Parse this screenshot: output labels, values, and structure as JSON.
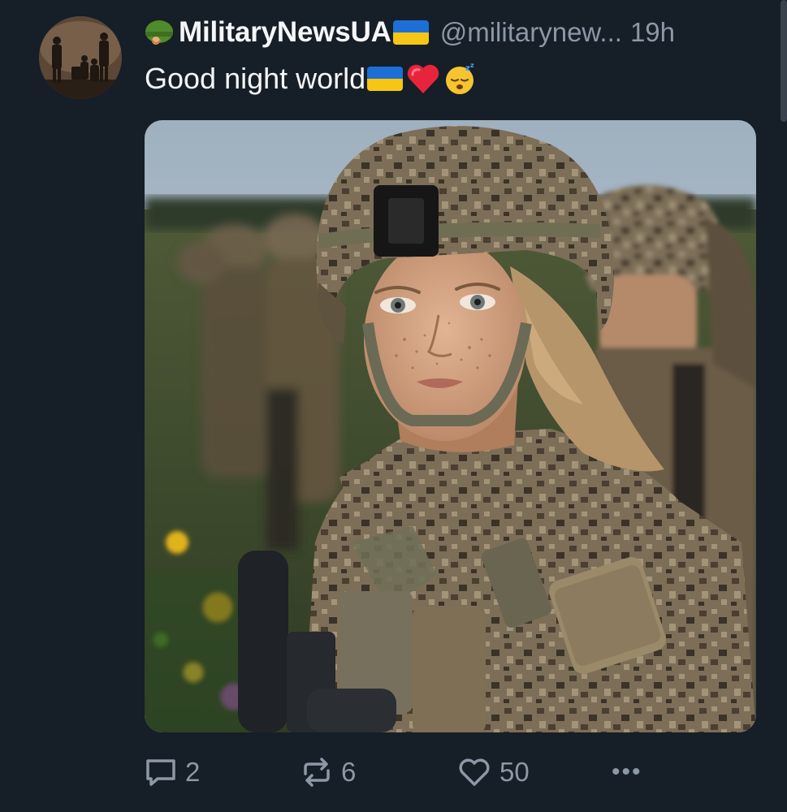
{
  "author": {
    "display_name": "MilitaryNewsUA",
    "handle": "@militarynew...",
    "time": "19h",
    "badge_icon": "military-helmet-emoji",
    "flag_icon": "ukraine-flag-emoji",
    "flag_colors": [
      "#1d6fd6",
      "#f7c614"
    ]
  },
  "post": {
    "text": "Good night world",
    "emojis": [
      "ukraine-flag-emoji",
      "red-heart-emoji",
      "sleeping-face-emoji"
    ]
  },
  "media": {
    "subject": "soldier-photo"
  },
  "stats": {
    "replies": "2",
    "reposts": "6",
    "likes": "50"
  },
  "more_label": "•••",
  "colors": {
    "background": "#161e27",
    "muted_text": "#8c98a5",
    "primary_text": "#f4f6f8"
  }
}
